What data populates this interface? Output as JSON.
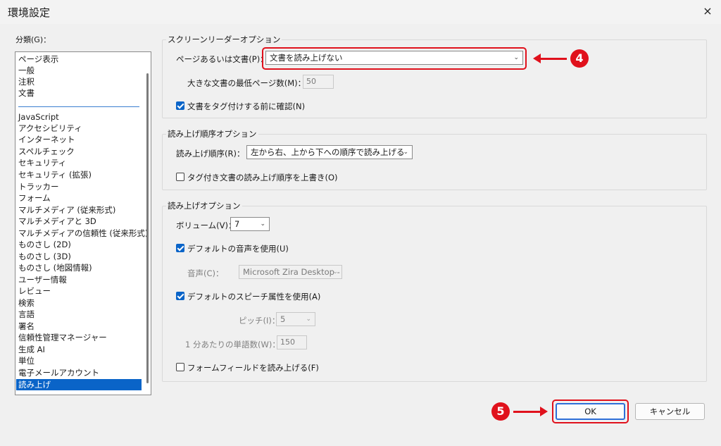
{
  "window": {
    "title": "環境設定",
    "close_icon": "×"
  },
  "categories": {
    "label": "分類(G)：",
    "items": [
      "ページ表示",
      "一般",
      "注釈",
      "文書",
      "JavaScript",
      "アクセシビリティ",
      "インターネット",
      "スペルチェック",
      "セキュリティ",
      "セキュリティ (拡張)",
      "トラッカー",
      "フォーム",
      "マルチメディア (従来形式)",
      "マルチメディアと 3D",
      "マルチメディアの信頼性 (従来形式)",
      "ものさし (2D)",
      "ものさし (3D)",
      "ものさし (地図情報)",
      "ユーザー情報",
      "レビュー",
      "検索",
      "言語",
      "署名",
      "信頼性管理マネージャー",
      "生成 AI",
      "単位",
      "電子メールアカウント",
      "読み上げ"
    ],
    "selected": "読み上げ"
  },
  "screen_reader": {
    "title": "スクリーンリーダーオプション",
    "page_or_doc_label": "ページあるいは文書(P)：",
    "page_or_doc_value": "文書を読み上げない",
    "min_pages_label": "大きな文書の最低ページ数(M)：",
    "min_pages_value": "50",
    "confirm_tag_label": "文書をタグ付けする前に確認(N)",
    "confirm_tag_checked": true
  },
  "reading_order": {
    "title": "読み上げ順序オプション",
    "order_label": "読み上げ順序(R)：",
    "order_value": "左から右、上から下への順序で読み上げる",
    "override_label": "タグ付き文書の読み上げ順序を上書き(O)",
    "override_checked": false
  },
  "reading": {
    "title": "読み上げオプション",
    "volume_label": "ボリューム(V)：",
    "volume_value": "7",
    "default_voice_label": "デフォルトの音声を使用(U)",
    "default_voice_checked": true,
    "voice_label": "音声(C)：",
    "voice_value": "Microsoft Zira Desktop -",
    "default_speech_label": "デフォルトのスピーチ属性を使用(A)",
    "default_speech_checked": true,
    "pitch_label": "ピッチ(I)：",
    "pitch_value": "5",
    "wpm_label": "1 分あたりの単語数(W)：",
    "wpm_value": "150",
    "read_form_label": "フォームフィールドを読み上げる(F)",
    "read_form_checked": false
  },
  "buttons": {
    "ok": "OK",
    "cancel": "キャンセル"
  },
  "annotations": {
    "step4": "4",
    "step5": "5",
    "color": "#e0111c"
  }
}
